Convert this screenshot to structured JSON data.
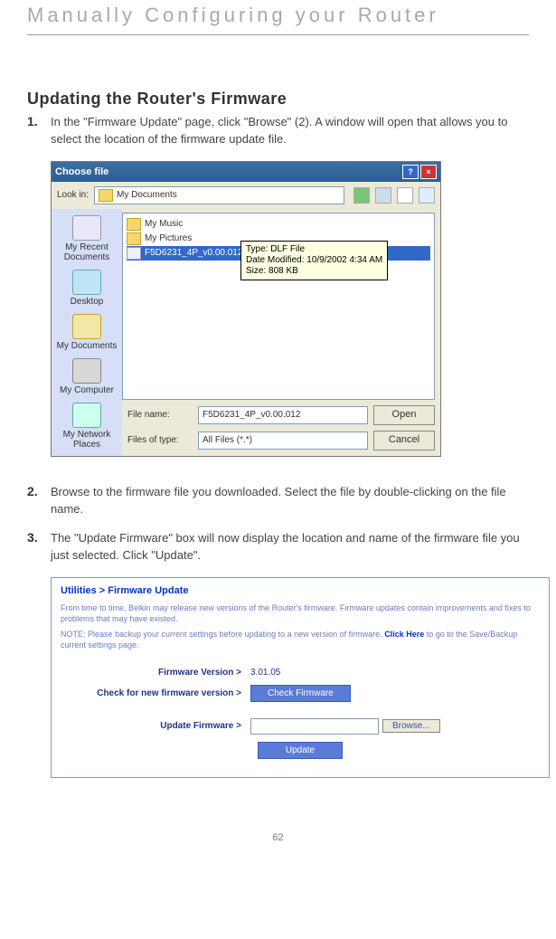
{
  "chapter": "Manually Configuring your Router",
  "section": "Updating the Router's Firmware",
  "steps": {
    "s1": {
      "num": "1.",
      "text": "In the \"Firmware Update\" page, click \"Browse\" (2). A window will open that allows you to select the location of the firmware update file."
    },
    "s2": {
      "num": "2.",
      "text": "Browse to the firmware file you downloaded. Select the file by double-clicking on the file name."
    },
    "s3": {
      "num": "3.",
      "text": "The \"Update Firmware\" box will now display the location and name of the firmware file you just selected. Click \"Update\"."
    }
  },
  "dialog": {
    "title": "Choose file",
    "lookin_label": "Look in:",
    "lookin_value": "My Documents",
    "places": {
      "recent": "My Recent Documents",
      "desktop": "Desktop",
      "mydocs": "My Documents",
      "mycomp": "My Computer",
      "network": "My Network Places"
    },
    "files": {
      "music": "My Music",
      "pictures": "My Pictures",
      "selected": "F5D6231_4P_v0.00.012.dlf"
    },
    "tooltip": {
      "l1": "Type: DLF File",
      "l2": "Date Modified: 10/9/2002 4:34 AM",
      "l3": "Size: 808 KB"
    },
    "filename_label": "File name:",
    "filename_value": "F5D6231_4P_v0.00.012",
    "filetype_label": "Files of type:",
    "filetype_value": "All Files (*.*)",
    "open_btn": "Open",
    "cancel_btn": "Cancel"
  },
  "fw": {
    "title": "Utilities > Firmware Update",
    "p1": "From time to time, Belkin may release new versions of the Router's firmware. Firmware updates contain improvements and fixes to problems that may have existed.",
    "p2a": "NOTE: Please backup your current settings before updating to a new version of firmware. ",
    "p2_link": "Click Here",
    "p2b": " to go to the Save/Backup current settings page.",
    "row1_lbl": "Firmware Version >",
    "row1_val": "3.01.05",
    "row2_lbl": "Check for new firmware version >",
    "row2_btn": "Check Firmware",
    "row3_lbl": "Update Firmware >",
    "browse": "Browse...",
    "update": "Update"
  },
  "pagenum": "62"
}
